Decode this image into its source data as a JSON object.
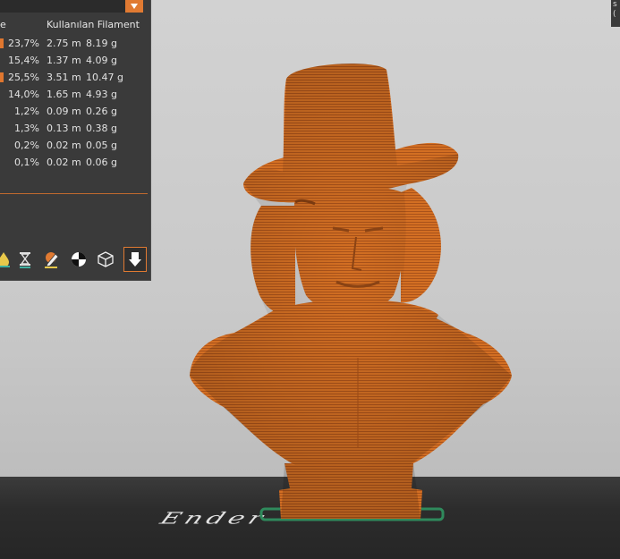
{
  "panel": {
    "header_left": "e",
    "header_right": "Kullanılan Filament",
    "accent_color": "#e07a32",
    "rows": [
      {
        "percent": "23,7%",
        "length": "2.75 m",
        "weight": "8.19 g",
        "swatch": true
      },
      {
        "percent": "15,4%",
        "length": "1.37 m",
        "weight": "4.09 g",
        "swatch": false
      },
      {
        "percent": "25,5%",
        "length": "3.51 m",
        "weight": "10.47 g",
        "swatch": true
      },
      {
        "percent": "14,0%",
        "length": "1.65 m",
        "weight": "4.93 g",
        "swatch": false
      },
      {
        "percent": "1,2%",
        "length": "0.09 m",
        "weight": "0.26 g",
        "swatch": false
      },
      {
        "percent": "1,3%",
        "length": "0.13 m",
        "weight": "0.38 g",
        "swatch": false
      },
      {
        "percent": "0,2%",
        "length": "0.02 m",
        "weight": "0.05 g",
        "swatch": false
      },
      {
        "percent": "0,1%",
        "length": "0.02 m",
        "weight": "0.06 g",
        "swatch": false
      }
    ],
    "toolbar": [
      {
        "name": "color-drop-icon"
      },
      {
        "name": "hourglass-icon"
      },
      {
        "name": "edit-pencil-icon"
      },
      {
        "name": "contrast-disc-icon"
      },
      {
        "name": "cube-wireframe-icon"
      },
      {
        "name": "export-arrow-icon"
      }
    ]
  },
  "corner_panel": {
    "line1": "s",
    "line2": "("
  },
  "viewport": {
    "bed_logo": "Ender",
    "model_color": "#d2691e",
    "bed_color": "#2c2c2c",
    "background_color": "#cccccc"
  }
}
